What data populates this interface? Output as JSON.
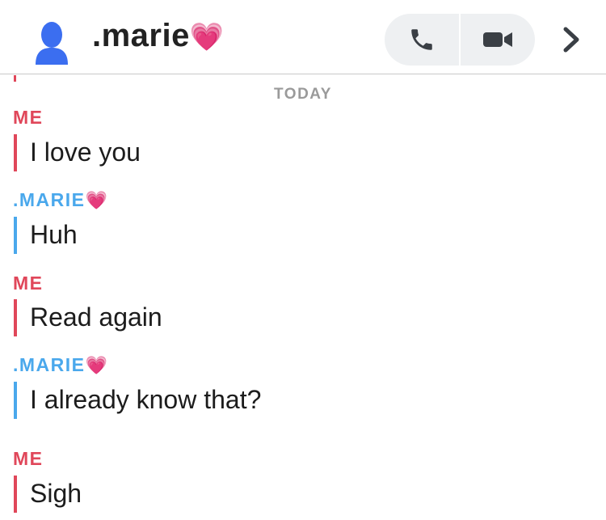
{
  "header": {
    "contact_name": ".marie",
    "heart_emoji": "💗",
    "call_icon": "phone-icon",
    "video_icon": "video-camera-icon",
    "more_icon": "chevron-right-icon"
  },
  "divider_label": "TODAY",
  "colors": {
    "me": "#e0475a",
    "her": "#4aa8ec",
    "pill_bg": "#eef0f2"
  },
  "messages": [
    {
      "sender": "ME",
      "text": "I love you"
    },
    {
      "sender": ".MARIE",
      "sender_emoji": "💗",
      "text": "Huh"
    },
    {
      "sender": "ME",
      "text": "Read again"
    },
    {
      "sender": ".MARIE",
      "sender_emoji": "💗",
      "text": "I already know that?"
    },
    {
      "sender": "ME",
      "text": "Sigh"
    }
  ]
}
